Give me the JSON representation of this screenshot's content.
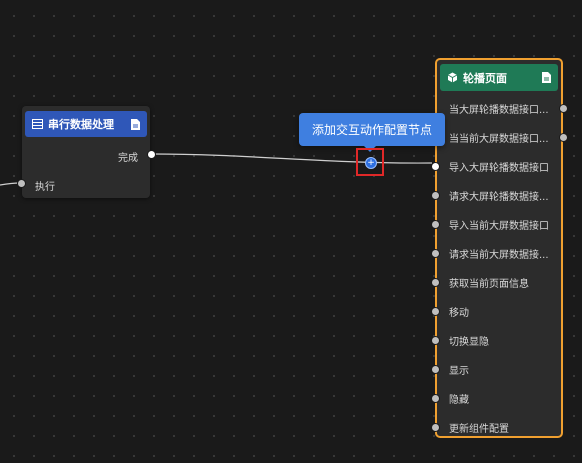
{
  "serial_node": {
    "title": "串行数据处理",
    "output_label": "完成",
    "input_label": "执行",
    "header_color": "#2f57b8"
  },
  "carousel_node": {
    "title": "轮播页面",
    "header_color": "#1f7a56",
    "border_color": "#f0a030",
    "items": [
      {
        "label": "当大屏轮播数据接口..."
      },
      {
        "label": "当当前大屏数据接口..."
      },
      {
        "label": "导入大屏轮播数据接口"
      },
      {
        "label": "请求大屏轮播数据接..."
      },
      {
        "label": "导入当前大屏数据接口"
      },
      {
        "label": "请求当前大屏数据接..."
      },
      {
        "label": "获取当前页面信息"
      },
      {
        "label": "移动"
      },
      {
        "label": "切换显隐"
      },
      {
        "label": "显示"
      },
      {
        "label": "隐藏"
      },
      {
        "label": "更新组件配置"
      }
    ]
  },
  "tooltip": {
    "text": "添加交互动作配置节点"
  },
  "add_button": {
    "glyph": "+",
    "highlight_color": "#e02828"
  }
}
